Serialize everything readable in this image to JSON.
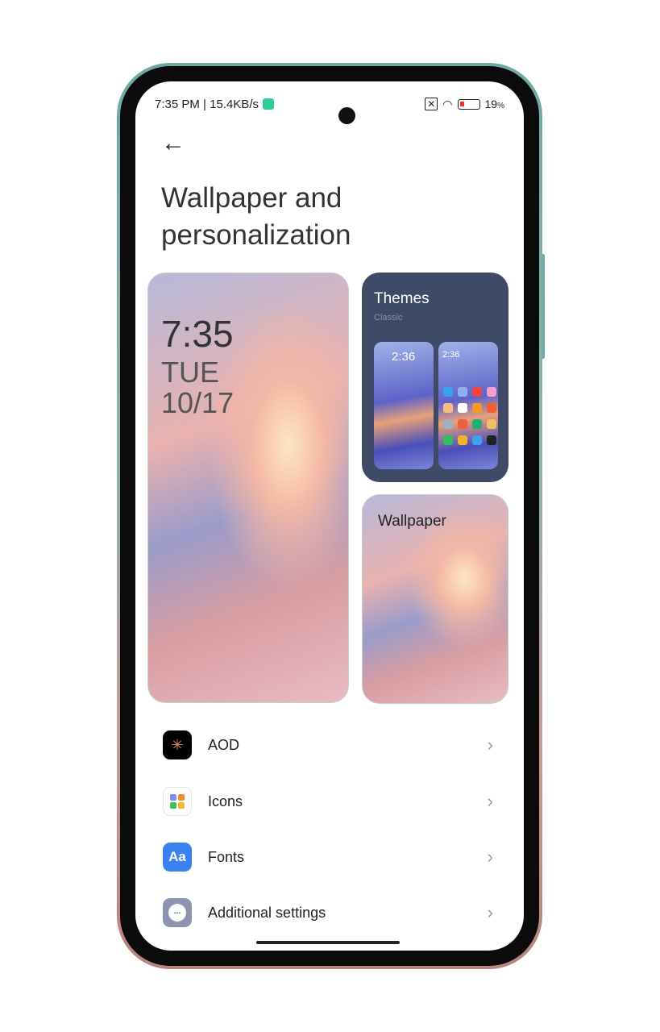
{
  "status": {
    "time": "7:35 PM",
    "speed": "15.4KB/s",
    "battery": "19",
    "battery_unit": "%"
  },
  "page": {
    "title": "Wallpaper and personalization"
  },
  "lockscreen": {
    "time": "7:35",
    "day": "TUE",
    "date": "10/17"
  },
  "themes": {
    "title": "Themes",
    "subtitle": "Classic",
    "preview_time": "2:36"
  },
  "wallpaper": {
    "title": "Wallpaper"
  },
  "items": [
    {
      "label": "AOD",
      "icon": "aod-icon"
    },
    {
      "label": "Icons",
      "icon": "icons-icon"
    },
    {
      "label": "Fonts",
      "icon": "fonts-icon",
      "glyph": "Aa"
    },
    {
      "label": "Additional settings",
      "icon": "more-icon",
      "glyph": "•••"
    }
  ]
}
